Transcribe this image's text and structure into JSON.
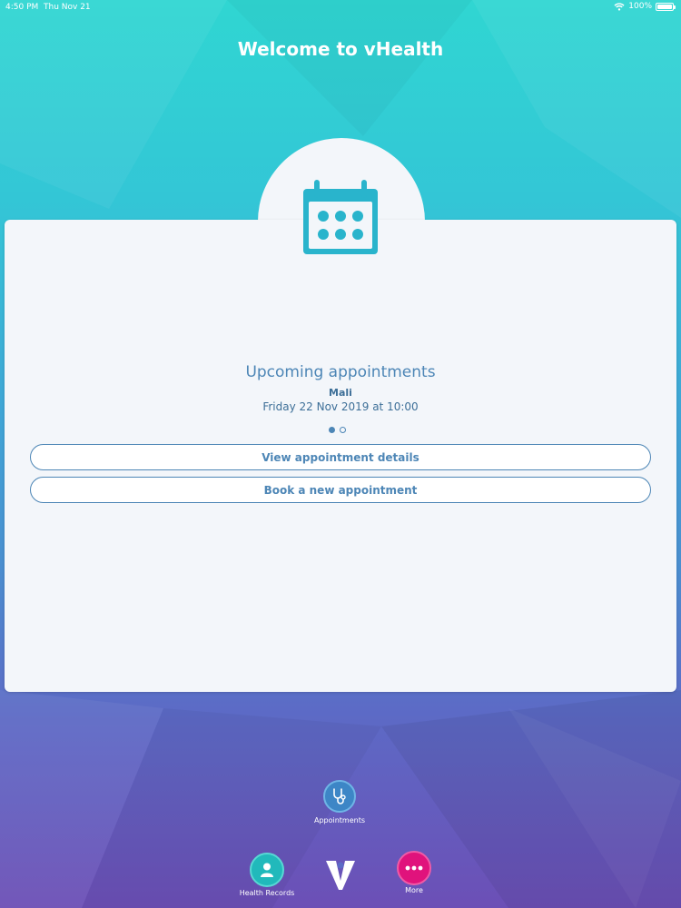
{
  "status_bar": {
    "time": "4:50 PM",
    "date": "Thu Nov 21",
    "battery": "100%",
    "wifi_icon": "wifi-icon",
    "battery_icon": "battery-icon"
  },
  "header": {
    "title": "Welcome to vHealth"
  },
  "card": {
    "icon": "calendar-icon",
    "heading": "Upcoming appointments",
    "name": "Mali",
    "datetime": "Friday 22 Nov 2019 at 10:00",
    "page_indicator": {
      "count": 2,
      "active": 0
    },
    "buttons": {
      "view_details": "View appointment details",
      "book_new": "Book a new appointment"
    }
  },
  "bottom_nav": {
    "appointments": {
      "label": "Appointments",
      "icon": "stethoscope-icon"
    },
    "health_records": {
      "label": "Health Records",
      "icon": "person-icon"
    },
    "logo": {
      "icon": "vhealth-logo-icon"
    },
    "more": {
      "label": "More",
      "icon": "more-dots-icon"
    }
  },
  "colors": {
    "accent": "#4d86b6",
    "card_background": "#f3f6fa",
    "calendar_icon": "#29b4cc",
    "health_records_button": "#21b9bb",
    "appointments_button": "#3d86c6",
    "more_button": "#e0137c"
  }
}
